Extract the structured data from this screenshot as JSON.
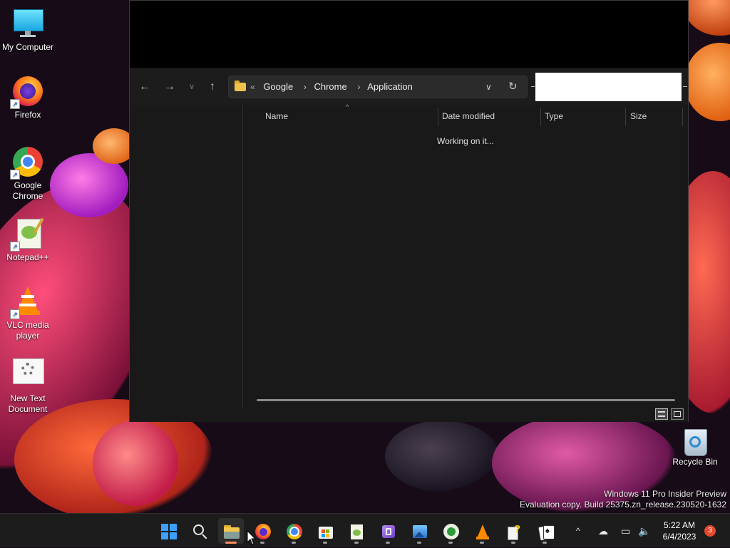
{
  "desktop": {
    "icons": [
      {
        "label": "My Computer",
        "icon": "monitor-icon"
      },
      {
        "label": "Firefox",
        "icon": "firefox-icon"
      },
      {
        "label": "Google Chrome",
        "icon": "chrome-icon"
      },
      {
        "label": "Notepad++",
        "icon": "notepadpp-icon"
      },
      {
        "label": "VLC media player",
        "icon": "vlc-icon"
      },
      {
        "label": "New Text Document",
        "icon": "text-document-icon"
      }
    ],
    "recycle_bin": {
      "label": "Recycle Bin",
      "icon": "recycle-bin-icon"
    },
    "watermark": {
      "line1": "Windows 11 Pro Insider Preview",
      "line2": "Evaluation copy. Build 25375.zn_release.230520-1632"
    }
  },
  "explorer": {
    "nav": {
      "back": "back-arrow-icon",
      "forward": "forward-arrow-icon",
      "recent": "chevron-down-icon",
      "up": "up-arrow-icon"
    },
    "address": {
      "overflow": "«",
      "crumbs": [
        "Google",
        "Chrome",
        "Application"
      ],
      "separator": "›"
    },
    "search": {
      "value": ""
    },
    "columns": [
      "Name",
      "Date modified",
      "Type",
      "Size"
    ],
    "status_text": "Working on it...",
    "view_modes": [
      "details-view-icon",
      "large-icons-view-icon"
    ]
  },
  "taskbar": {
    "apps": [
      {
        "name": "start",
        "icon": "windows-start-icon"
      },
      {
        "name": "search",
        "icon": "search-icon"
      },
      {
        "name": "file-explorer",
        "icon": "folder-icon",
        "active": true
      },
      {
        "name": "firefox",
        "icon": "firefox-icon"
      },
      {
        "name": "chrome",
        "icon": "chrome-icon"
      },
      {
        "name": "microsoft-store",
        "icon": "store-icon"
      },
      {
        "name": "notepadpp",
        "icon": "notepadpp-icon"
      },
      {
        "name": "visual-studio",
        "icon": "visual-studio-icon"
      },
      {
        "name": "photos",
        "icon": "photos-icon"
      },
      {
        "name": "xbox",
        "icon": "xbox-icon"
      },
      {
        "name": "vlc",
        "icon": "vlc-icon"
      },
      {
        "name": "help",
        "icon": "help-icon"
      },
      {
        "name": "solitaire",
        "icon": "solitaire-icon"
      }
    ],
    "tray": {
      "chevron": "^",
      "network_icon": "network-icon",
      "volume_icon": "volume-icon"
    },
    "clock": {
      "time": "5:22 AM",
      "date": "6/4/2023"
    },
    "notifications": "3"
  },
  "colors": {
    "accent": "#ff8b5e",
    "folder": "#f0c24a"
  }
}
